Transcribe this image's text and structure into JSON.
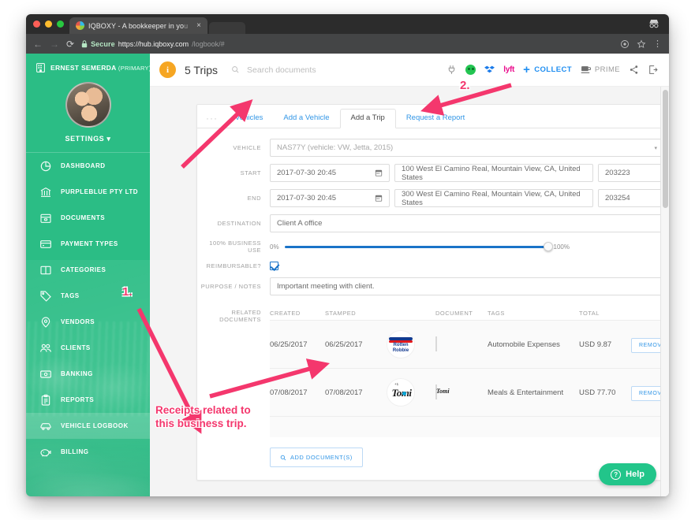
{
  "browser": {
    "tab_title": "IQBOXY - A bookkeeper in yo",
    "tab_title_dim": "u",
    "tab_close": "×",
    "back": "←",
    "forward": "→",
    "reload": "⟳",
    "secure_label": "Secure",
    "url_main": "https://hub.iqboxy.com",
    "url_dim": "/logbook/#",
    "menu": "⋮"
  },
  "sidebar": {
    "org_name": "ERNEST SEMERDA",
    "org_suffix": "(PRIMARY)",
    "settings_label": "SETTINGS",
    "caret": "▾",
    "items": [
      {
        "label": "DASHBOARD",
        "icon": "pie-chart-icon",
        "active": false
      },
      {
        "label": "PURPLEBLUE PTY LTD",
        "icon": "bank-icon",
        "active": false
      },
      {
        "label": "DOCUMENTS",
        "icon": "box-icon",
        "active": false
      },
      {
        "label": "PAYMENT TYPES",
        "icon": "credit-card-icon",
        "active": false
      },
      {
        "label": "CATEGORIES",
        "icon": "columns-icon",
        "active": false
      },
      {
        "label": "TAGS",
        "icon": "tag-icon",
        "active": false
      },
      {
        "label": "VENDORS",
        "icon": "map-pin-icon",
        "active": false
      },
      {
        "label": "CLIENTS",
        "icon": "people-icon",
        "active": false
      },
      {
        "label": "BANKING",
        "icon": "money-icon",
        "active": false
      },
      {
        "label": "REPORTS",
        "icon": "clipboard-icon",
        "active": false
      },
      {
        "label": "VEHICLE LOGBOOK",
        "icon": "car-icon",
        "active": true
      },
      {
        "label": "BILLING",
        "icon": "piggy-bank-icon",
        "active": false
      }
    ]
  },
  "topbar": {
    "badge": "i",
    "title": "5 Trips",
    "search_placeholder": "Search documents",
    "collect_label": "COLLECT",
    "collect_plus": "+",
    "prime_label": "PRIME",
    "lyft_label": "lyft",
    "icons": [
      "plug-icon",
      "mint-icon",
      "dropbox-icon",
      "lyft-icon",
      "share-icon",
      "logout-icon"
    ]
  },
  "card": {
    "tabs": [
      {
        "label": "Vehicles",
        "selected": false
      },
      {
        "label": "Add a Vehicle",
        "selected": false
      },
      {
        "label": "Add a Trip",
        "selected": true
      },
      {
        "label": "Request a Report",
        "selected": false
      }
    ],
    "dots": "···",
    "form": {
      "vehicle_label": "VEHICLE",
      "vehicle_value": "NAS77Y (vehicle: VW, Jetta, 2015)",
      "start_label": "START",
      "start_date": "2017-07-30 20:45",
      "start_address": "100 West El Camino Real, Mountain View, CA, United States",
      "start_odometer": "203223",
      "end_label": "END",
      "end_date": "2017-07-30 20:45",
      "end_address": "300 West El Camino Real, Mountain View, CA, United States",
      "end_odometer": "203254",
      "destination_label": "DESTINATION",
      "destination_value": "Client A office",
      "business_use_label": "100% BUSINESS USE",
      "slider_min": "0%",
      "slider_max": "100%",
      "reimbursable_label": "REIMBURSABLE?",
      "purpose_label": "PURPOSE / NOTES",
      "purpose_value": "Important meeting with client."
    },
    "documents": {
      "section_label": "RELATED DOCUMENTS",
      "columns": [
        "CREATED",
        "STAMPED",
        "",
        "DOCUMENT",
        "TAGS",
        "TOTAL",
        ""
      ],
      "rows": [
        {
          "created": "06/25/2017",
          "stamped": "06/25/2017",
          "vendor": "Rotten Robbie",
          "tags": "Automobile Expenses",
          "total": "USD 9.87",
          "action": "REMOVE"
        },
        {
          "created": "07/08/2017",
          "stamped": "07/08/2017",
          "vendor": "Tomi",
          "tags": "Meals & Entertainment",
          "total": "USD 77.70",
          "action": "REMOVE"
        }
      ],
      "add_label": "ADD DOCUMENT(S)"
    }
  },
  "help": {
    "label": "Help",
    "glyph": "?"
  },
  "annotations": {
    "one": "1.",
    "two": "2.",
    "receipts_note": "Receipts related to\nthis business trip.",
    "color": "#f4376d"
  }
}
